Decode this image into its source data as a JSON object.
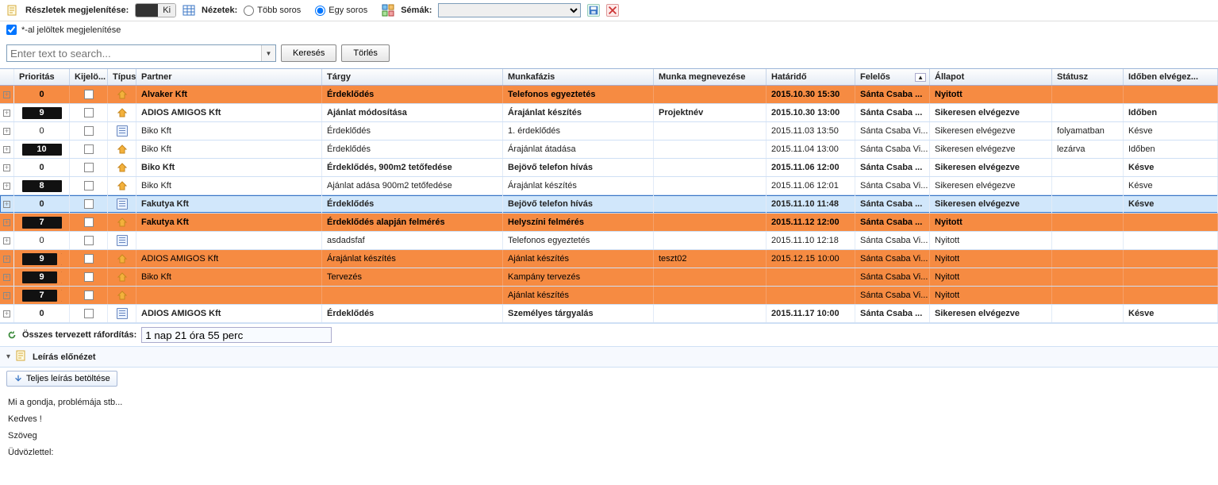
{
  "toolbar": {
    "details_label": "Részletek megjelenítése:",
    "toggle_text": "Ki",
    "views_label": "Nézetek:",
    "view_multi": "Több soros",
    "view_single": "Egy soros",
    "schemas_label": "Sémák:",
    "star_checkbox_label": "*-al jelöltek megjelenítése"
  },
  "search": {
    "placeholder": "Enter text to search...",
    "search_btn": "Keresés",
    "clear_btn": "Törlés"
  },
  "columns": {
    "prioritas": "Prioritás",
    "kijelo": "Kijelö...",
    "tipus": "Típus",
    "partner": "Partner",
    "targy": "Tárgy",
    "munkafazis": "Munkafázis",
    "munka_meg": "Munka megnevezése",
    "hatarido": "Határidő",
    "felelos": "Felelős",
    "allapot": "Állapot",
    "statusz": "Státusz",
    "idoben": "Időben elvégez..."
  },
  "rows": [
    {
      "prio": "0",
      "prio_style": "plain",
      "type": "call",
      "partner": "Alvaker Kft",
      "targy": "Érdeklődés",
      "munk": "Telefonos egyeztetés",
      "meg": "",
      "hat": "2015.10.30 15:30",
      "fel": "Sánta Csaba ...",
      "all": "Nyitott",
      "stat": "",
      "ido": "",
      "cls": "orange boldrow"
    },
    {
      "prio": "9",
      "prio_style": "badge",
      "type": "call",
      "partner": "ADIOS AMIGOS Kft",
      "targy": "Ajánlat módosítása",
      "munk": "Árajánlat készítés",
      "meg": "Projektnév",
      "hat": "2015.10.30 13:00",
      "fel": "Sánta Csaba ...",
      "all": "Sikeresen elvégezve",
      "stat": "",
      "ido": "Időben",
      "cls": "boldrow"
    },
    {
      "prio": "0",
      "prio_style": "plain",
      "type": "doc",
      "partner": "Biko Kft",
      "targy": "Érdeklődés",
      "munk": "1. érdeklődés",
      "meg": "",
      "hat": "2015.11.03 13:50",
      "fel": "Sánta Csaba Vi...",
      "all": "Sikeresen elvégezve",
      "stat": "folyamatban",
      "ido": "Késve",
      "cls": ""
    },
    {
      "prio": "10",
      "prio_style": "badge",
      "type": "call",
      "partner": "Biko Kft",
      "targy": "Érdeklődés",
      "munk": "Árajánlat átadása",
      "meg": "",
      "hat": "2015.11.04 13:00",
      "fel": "Sánta Csaba Vi...",
      "all": "Sikeresen elvégezve",
      "stat": "lezárva",
      "ido": "Időben",
      "cls": ""
    },
    {
      "prio": "0",
      "prio_style": "plain",
      "type": "call",
      "partner": "Biko Kft",
      "targy": "Érdeklődés, 900m2 tetőfedése",
      "munk": "Bejövő telefon hívás",
      "meg": "",
      "hat": "2015.11.06 12:00",
      "fel": "Sánta Csaba ...",
      "all": "Sikeresen elvégezve",
      "stat": "",
      "ido": "Késve",
      "cls": "boldrow"
    },
    {
      "prio": "8",
      "prio_style": "badge",
      "type": "call",
      "partner": "Biko Kft",
      "targy": "Ajánlat adása 900m2 tetőfedése",
      "munk": "Árajánlat készítés",
      "meg": "",
      "hat": "2015.11.06 12:01",
      "fel": "Sánta Csaba Vi...",
      "all": "Sikeresen elvégezve",
      "stat": "",
      "ido": "Késve",
      "cls": ""
    },
    {
      "prio": "0",
      "prio_style": "plain",
      "type": "doc",
      "partner": "Fakutya Kft",
      "targy": "Érdeklődés",
      "munk": "Bejövő telefon hívás",
      "meg": "",
      "hat": "2015.11.10 11:48",
      "fel": "Sánta Csaba ...",
      "all": "Sikeresen elvégezve",
      "stat": "",
      "ido": "Késve",
      "cls": "lightblue sel"
    },
    {
      "prio": "7",
      "prio_style": "badge",
      "type": "call",
      "partner": "Fakutya Kft",
      "targy": "Érdeklődés alapján felmérés",
      "munk": "Helyszíni felmérés",
      "meg": "",
      "hat": "2015.11.12 12:00",
      "fel": "Sánta Csaba ...",
      "all": "Nyitott",
      "stat": "",
      "ido": "",
      "cls": "orange boldrow"
    },
    {
      "prio": "0",
      "prio_style": "plain",
      "type": "doc",
      "partner": "",
      "targy": "asdadsfaf",
      "munk": "Telefonos egyeztetés",
      "meg": "",
      "hat": "2015.11.10 12:18",
      "fel": "Sánta Csaba Vi...",
      "all": "Nyitott",
      "stat": "",
      "ido": "",
      "cls": ""
    },
    {
      "prio": "9",
      "prio_style": "badge-oe",
      "type": "call",
      "partner": "ADIOS AMIGOS Kft",
      "targy": "Árajánlat készítés",
      "munk": "Ajánlat készítés",
      "meg": "teszt02",
      "hat": "2015.12.15 10:00",
      "fel": "Sánta Csaba Vi...",
      "all": "Nyitott",
      "stat": "",
      "ido": "",
      "cls": "orange"
    },
    {
      "prio": "9",
      "prio_style": "badge-oe",
      "type": "call",
      "partner": "Biko Kft",
      "targy": "Tervezés",
      "munk": "Kampány tervezés",
      "meg": "",
      "hat": "",
      "fel": "Sánta Csaba Vi...",
      "all": "Nyitott",
      "stat": "",
      "ido": "",
      "cls": "orange"
    },
    {
      "prio": "7",
      "prio_style": "badge-oe",
      "type": "call",
      "partner": "",
      "targy": "",
      "munk": "Ajánlat készítés",
      "meg": "",
      "hat": "",
      "fel": "Sánta Csaba Vi...",
      "all": "Nyitott",
      "stat": "",
      "ido": "",
      "cls": "orange"
    },
    {
      "prio": "0",
      "prio_style": "plain",
      "type": "doc",
      "partner": "ADIOS AMIGOS Kft",
      "targy": "Érdeklődés",
      "munk": "Személyes tárgyalás",
      "meg": "",
      "hat": "2015.11.17 10:00",
      "fel": "Sánta Csaba ...",
      "all": "Sikeresen elvégezve",
      "stat": "",
      "ido": "Késve",
      "cls": "boldrow"
    }
  ],
  "footer": {
    "total_label": "Összes tervezett ráfordítás:",
    "total_value": "1 nap 21 óra 55 perc",
    "preview_header": "Leírás előnézet",
    "load_full": "Teljes leírás betöltése",
    "body_l1": "Mi a gondja, problémája stb...",
    "body_l2": "Kedves !",
    "body_l3": "Szöveg",
    "body_l4": "Üdvözlettel:"
  }
}
